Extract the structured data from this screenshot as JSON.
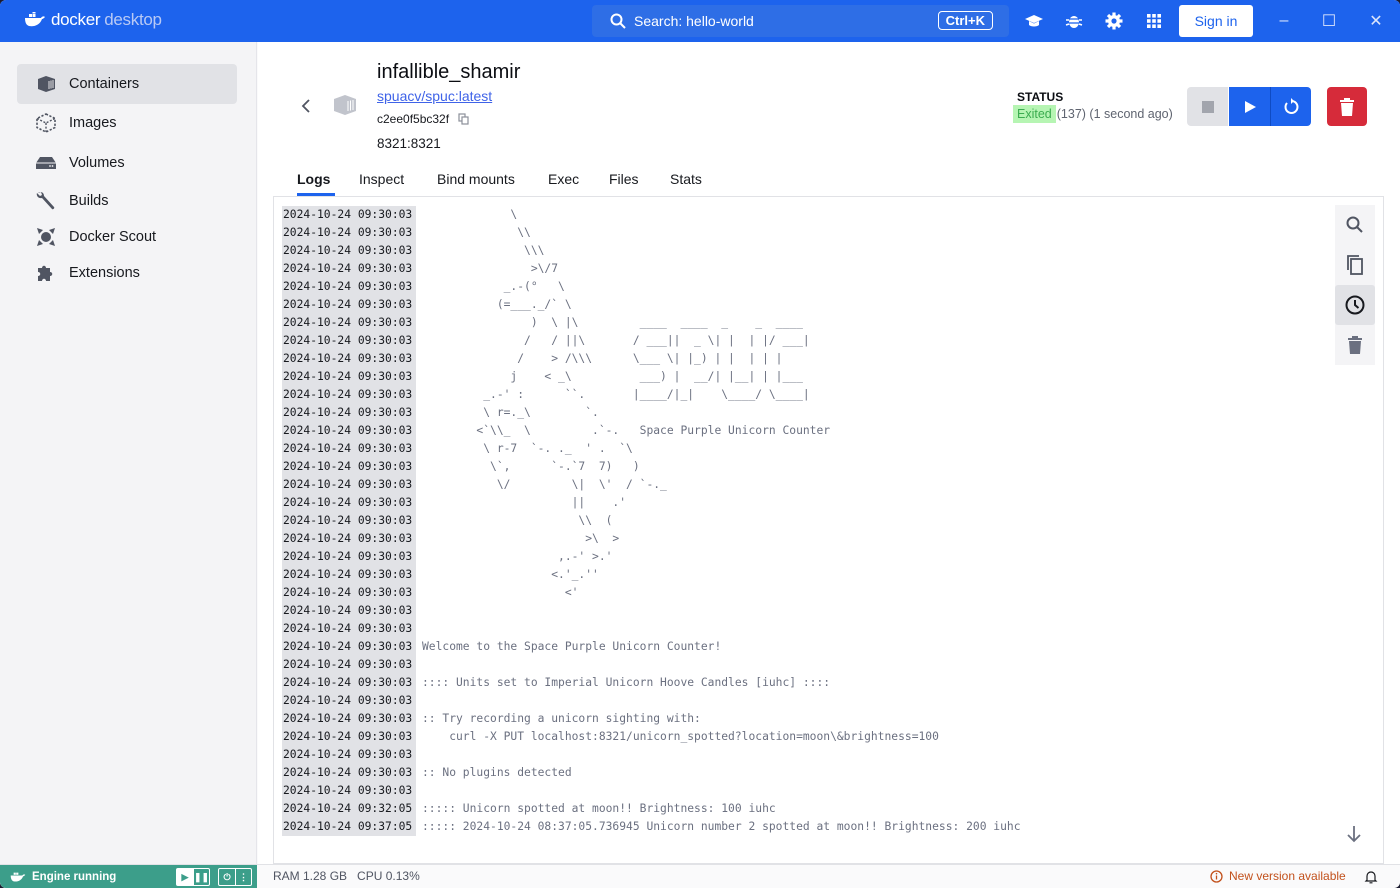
{
  "app": {
    "brand_primary": "docker",
    "brand_secondary": "desktop",
    "search_text": "Search: hello-world",
    "search_shortcut": "Ctrl+K",
    "sign_in": "Sign in",
    "toolbar_icons": [
      "learning-center-icon",
      "troubleshoot-bug-icon",
      "settings-gear-icon",
      "extensions-grid-icon"
    ],
    "window_controls": {
      "minimize": "–",
      "maximize": "☐",
      "close": "✕"
    }
  },
  "colors": {
    "accent": "#1d63ed",
    "danger": "#d62b3a",
    "engine": "#3c9e8a",
    "exited_bg": "#b6f5b3",
    "exited_fg": "#3bac4f",
    "warning": "#c2511c"
  },
  "sidebar": {
    "items": [
      {
        "label": "Containers",
        "icon": "container-icon",
        "active": true
      },
      {
        "label": "Images",
        "icon": "image-cube-icon",
        "active": false
      },
      {
        "label": "Volumes",
        "icon": "volume-drive-icon",
        "active": false
      },
      {
        "label": "Builds",
        "icon": "wrench-icon",
        "active": false
      },
      {
        "label": "Docker Scout",
        "icon": "scout-icon",
        "active": false
      },
      {
        "label": "Extensions",
        "icon": "puzzle-icon",
        "active": false
      }
    ]
  },
  "container": {
    "name": "infallible_shamir",
    "image": "spuacv/spuc:latest",
    "id": "c2ee0f5bc32f",
    "ports": "8321:8321",
    "status_label": "STATUS",
    "status_state": "Exited",
    "status_detail": "(137) (1 second ago)"
  },
  "tabs": [
    {
      "label": "Logs",
      "active": true
    },
    {
      "label": "Inspect",
      "active": false
    },
    {
      "label": "Bind mounts",
      "active": false
    },
    {
      "label": "Exec",
      "active": false
    },
    {
      "label": "Files",
      "active": false
    },
    {
      "label": "Stats",
      "active": false
    }
  ],
  "logs": [
    {
      "ts": "2024-10-24 09:30:03",
      "msg": "             \\"
    },
    {
      "ts": "2024-10-24 09:30:03",
      "msg": "              \\\\"
    },
    {
      "ts": "2024-10-24 09:30:03",
      "msg": "               \\\\\\"
    },
    {
      "ts": "2024-10-24 09:30:03",
      "msg": "                >\\/7"
    },
    {
      "ts": "2024-10-24 09:30:03",
      "msg": "            _.-(°   \\"
    },
    {
      "ts": "2024-10-24 09:30:03",
      "msg": "           (=___._/` \\"
    },
    {
      "ts": "2024-10-24 09:30:03",
      "msg": "                )  \\ |\\         ____  ____  _    _  ____"
    },
    {
      "ts": "2024-10-24 09:30:03",
      "msg": "               /   / ||\\       / ___||  _ \\| |  | |/ ___|"
    },
    {
      "ts": "2024-10-24 09:30:03",
      "msg": "              /    > /\\\\\\      \\___ \\| |_) | |  | | |"
    },
    {
      "ts": "2024-10-24 09:30:03",
      "msg": "             j    < _\\          ___) |  __/| |__| | |___"
    },
    {
      "ts": "2024-10-24 09:30:03",
      "msg": "         _.-' :      ``.       |____/|_|    \\____/ \\____|"
    },
    {
      "ts": "2024-10-24 09:30:03",
      "msg": "         \\ r=._\\        `."
    },
    {
      "ts": "2024-10-24 09:30:03",
      "msg": "        <`\\\\_  \\         .`-.   Space Purple Unicorn Counter"
    },
    {
      "ts": "2024-10-24 09:30:03",
      "msg": "         \\ r-7  `-. ._  ' .  `\\"
    },
    {
      "ts": "2024-10-24 09:30:03",
      "msg": "          \\`,      `-.`7  7)   )"
    },
    {
      "ts": "2024-10-24 09:30:03",
      "msg": "           \\/         \\|  \\'  / `-._"
    },
    {
      "ts": "2024-10-24 09:30:03",
      "msg": "                      ||    .'"
    },
    {
      "ts": "2024-10-24 09:30:03",
      "msg": "                       \\\\  ("
    },
    {
      "ts": "2024-10-24 09:30:03",
      "msg": "                        >\\  >"
    },
    {
      "ts": "2024-10-24 09:30:03",
      "msg": "                    ,.-' >.'"
    },
    {
      "ts": "2024-10-24 09:30:03",
      "msg": "                   <.'_.''"
    },
    {
      "ts": "2024-10-24 09:30:03",
      "msg": "                     <'"
    },
    {
      "ts": "2024-10-24 09:30:03",
      "msg": ""
    },
    {
      "ts": "2024-10-24 09:30:03",
      "msg": ""
    },
    {
      "ts": "2024-10-24 09:30:03",
      "msg": "Welcome to the Space Purple Unicorn Counter!"
    },
    {
      "ts": "2024-10-24 09:30:03",
      "msg": ""
    },
    {
      "ts": "2024-10-24 09:30:03",
      "msg": ":::: Units set to Imperial Unicorn Hoove Candles [iuhc] ::::"
    },
    {
      "ts": "2024-10-24 09:30:03",
      "msg": ""
    },
    {
      "ts": "2024-10-24 09:30:03",
      "msg": ":: Try recording a unicorn sighting with:"
    },
    {
      "ts": "2024-10-24 09:30:03",
      "msg": "    curl -X PUT localhost:8321/unicorn_spotted?location=moon\\&brightness=100"
    },
    {
      "ts": "2024-10-24 09:30:03",
      "msg": ""
    },
    {
      "ts": "2024-10-24 09:30:03",
      "msg": ":: No plugins detected"
    },
    {
      "ts": "2024-10-24 09:30:03",
      "msg": ""
    },
    {
      "ts": "2024-10-24 09:32:05",
      "msg": "::::: Unicorn spotted at moon!! Brightness: 100 iuhc"
    },
    {
      "ts": "2024-10-24 09:37:05",
      "msg": "::::: 2024-10-24 08:37:05.736945 Unicorn number 2 spotted at moon!! Brightness: 200 iuhc"
    }
  ],
  "log_tools": [
    "search-icon",
    "copy-icon",
    "timestamps-clock-icon",
    "clear-trash-icon"
  ],
  "footer": {
    "engine_status": "Engine running",
    "ram": "RAM 1.28 GB",
    "cpu": "CPU 0.13%",
    "new_version": "New version available"
  }
}
